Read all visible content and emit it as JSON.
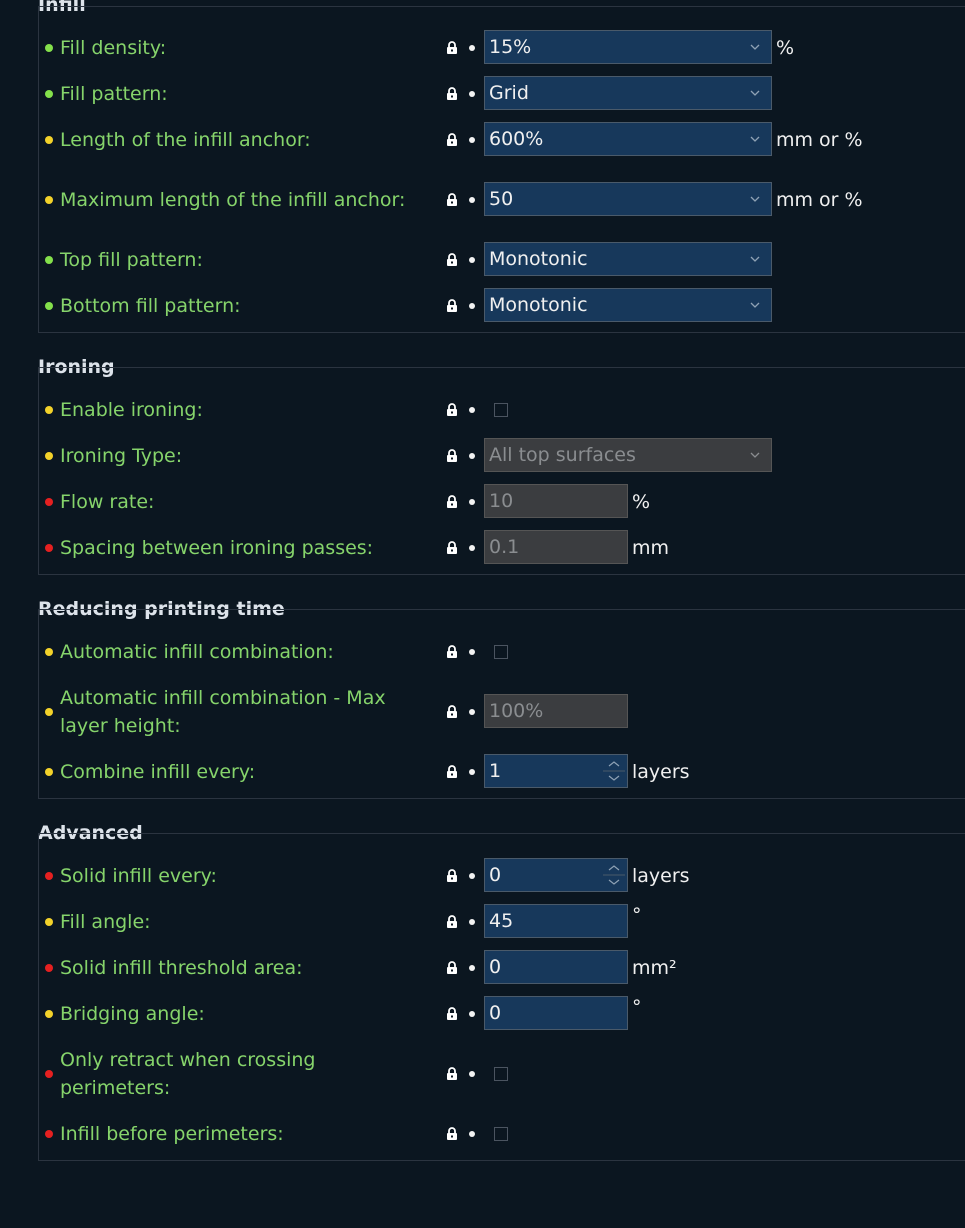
{
  "colors": {
    "green": "#84e04b",
    "yellow": "#f3d22a",
    "red": "#e52020",
    "label": "#86d46b"
  },
  "sections": {
    "infill": {
      "title": "Infill",
      "rows": [
        {
          "label": "Fill density:",
          "value": "15%",
          "unit": "%"
        },
        {
          "label": "Fill pattern:",
          "value": "Grid"
        },
        {
          "label": "Length of the infill anchor:",
          "value": "600%",
          "unit": "mm or %"
        },
        {
          "label": "Maximum length of the infill anchor:",
          "value": "50",
          "unit": "mm or %"
        },
        {
          "label": "Top fill pattern:",
          "value": "Monotonic"
        },
        {
          "label": "Bottom fill pattern:",
          "value": "Monotonic"
        }
      ]
    },
    "ironing": {
      "title": "Ironing",
      "rows": [
        {
          "label": "Enable ironing:"
        },
        {
          "label": "Ironing Type:",
          "value": "All top surfaces"
        },
        {
          "label": "Flow rate:",
          "value": "10",
          "unit": "%"
        },
        {
          "label": "Spacing between ironing passes:",
          "value": "0.1",
          "unit": "mm"
        }
      ]
    },
    "reducing": {
      "title": "Reducing printing time",
      "rows": [
        {
          "label": "Automatic infill combination:"
        },
        {
          "label": "Automatic infill combination - Max layer height:",
          "value": "100%"
        },
        {
          "label": "Combine infill every:",
          "value": "1",
          "unit": "layers"
        }
      ]
    },
    "advanced": {
      "title": "Advanced",
      "rows": [
        {
          "label": "Solid infill every:",
          "value": "0",
          "unit": "layers"
        },
        {
          "label": "Fill angle:",
          "value": "45",
          "unit": "°"
        },
        {
          "label": "Solid infill threshold area:",
          "value": "0",
          "unit": "mm²"
        },
        {
          "label": "Bridging angle:",
          "value": "0",
          "unit": "°"
        },
        {
          "label": "Only retract when crossing perimeters:"
        },
        {
          "label": "Infill before perimeters:"
        }
      ]
    }
  }
}
